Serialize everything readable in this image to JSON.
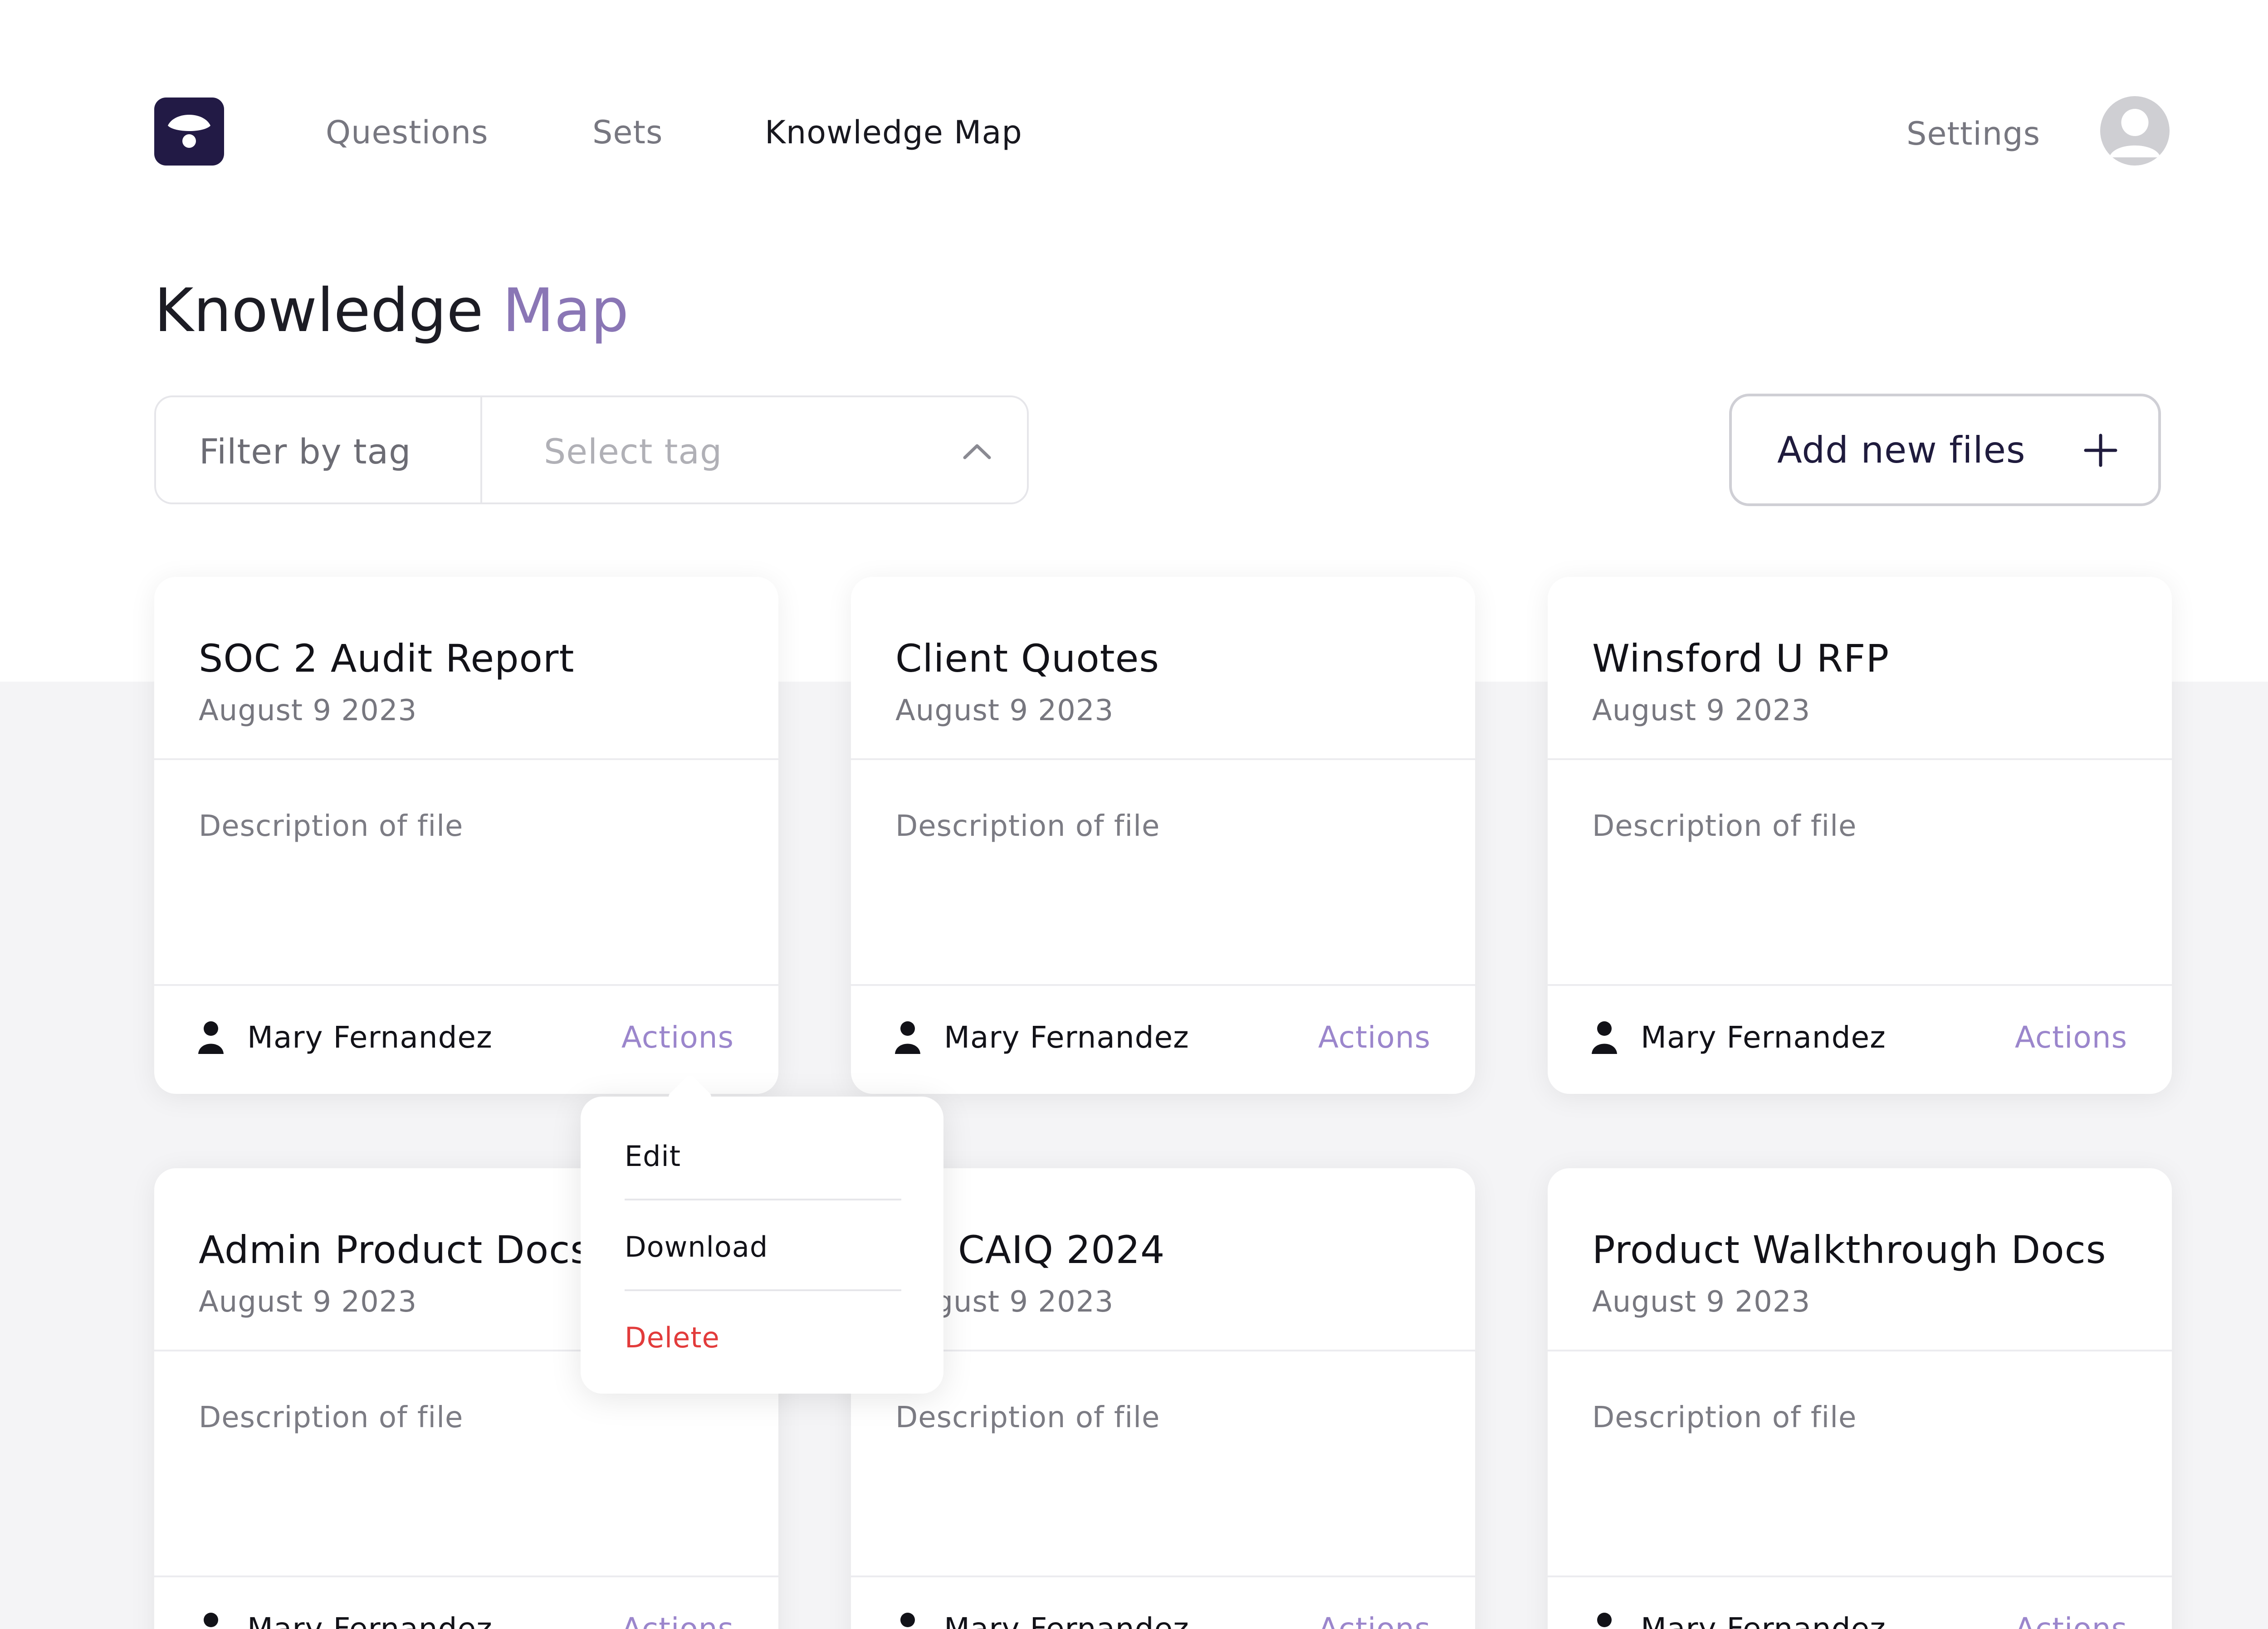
{
  "nav": {
    "logo": "app-logo",
    "links": [
      {
        "label": "Questions",
        "active": false
      },
      {
        "label": "Sets",
        "active": false
      },
      {
        "label": "Knowledge Map",
        "active": true
      }
    ],
    "settings_label": "Settings",
    "avatar_icon": "user-avatar-icon"
  },
  "page": {
    "title_main": "Knowledge ",
    "title_accent": "Map"
  },
  "filter": {
    "label": "Filter by tag",
    "placeholder": "Select tag",
    "icon": "chevron-up-icon"
  },
  "add_button": {
    "label": "Add new files",
    "icon": "plus-icon"
  },
  "cards": [
    {
      "title": "SOC 2 Audit Report",
      "date": "August 9 2023",
      "description": "Description of file",
      "user": "Mary Fernandez",
      "actions": "Actions"
    },
    {
      "title": "Client Quotes",
      "date": "August 9 2023",
      "description": "Description of file",
      "user": "Mary Fernandez",
      "actions": "Actions"
    },
    {
      "title": "Winsford U RFP",
      "date": "August 9 2023",
      "description": "Description of file",
      "user": "Mary Fernandez",
      "actions": "Actions"
    },
    {
      "title": "Admin Product Docs",
      "date": "August 9 2023",
      "description": "Description of file",
      "user": "Mary Fernandez",
      "actions": "Actions"
    },
    {
      "title": "CAIQ 2024",
      "date": "August 9 2023",
      "description": "Description of file",
      "user": "Mary Fernandez",
      "actions": "Actions"
    },
    {
      "title": "Product Walkthrough Docs",
      "date": "August 9 2023",
      "description": "Description of file",
      "user": "Mary Fernandez",
      "actions": "Actions"
    }
  ],
  "actions_menu": {
    "items": [
      {
        "label": "Edit"
      },
      {
        "label": "Download"
      },
      {
        "label": "Delete",
        "danger": true
      }
    ]
  },
  "colors": {
    "brand": "#221a45",
    "accent": "#8a76b5",
    "link": "#9b86cc",
    "danger": "#e23b3b",
    "background_band": "#f4f4f6"
  }
}
